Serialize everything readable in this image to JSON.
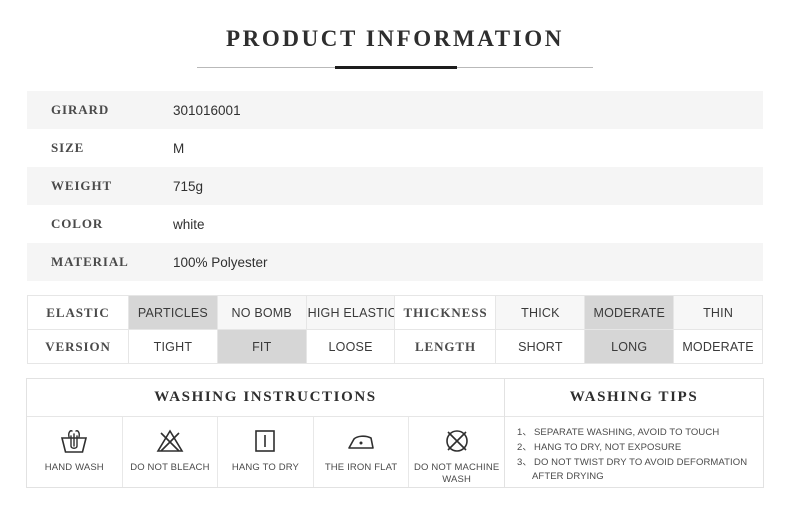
{
  "header": {
    "title": "PRODUCT INFORMATION"
  },
  "spec_table": {
    "rows": [
      {
        "label": "GIRARD",
        "value": "301016001"
      },
      {
        "label": "SIZE",
        "value": "M"
      },
      {
        "label": "WEIGHT",
        "value": "715g"
      },
      {
        "label": "COLOR",
        "value": "white"
      },
      {
        "label": "MATERIAL",
        "value": "100% Polyester"
      }
    ]
  },
  "attributes": {
    "rows": [
      {
        "left_label": "ELASTIC",
        "left_options": [
          {
            "text": "PARTICLES",
            "selected": true
          },
          {
            "text": "NO BOMB",
            "selected": false
          },
          {
            "text": "HIGH ELASTIC",
            "selected": false
          }
        ],
        "right_label": "THICKNESS",
        "right_options": [
          {
            "text": "THICK",
            "selected": false
          },
          {
            "text": "MODERATE",
            "selected": true
          },
          {
            "text": "THIN",
            "selected": false
          }
        ]
      },
      {
        "left_label": "VERSION",
        "left_options": [
          {
            "text": "TIGHT",
            "selected": false
          },
          {
            "text": "FIT",
            "selected": true
          },
          {
            "text": "LOOSE",
            "selected": false
          }
        ],
        "right_label": "LENGTH",
        "right_options": [
          {
            "text": "SHORT",
            "selected": false
          },
          {
            "text": "LONG",
            "selected": true
          },
          {
            "text": "MODERATE",
            "selected": false
          }
        ]
      }
    ]
  },
  "washing_instructions": {
    "heading": "WASHING INSTRUCTIONS",
    "items": [
      {
        "icon": "hand-wash-icon",
        "label": "HAND WASH"
      },
      {
        "icon": "do-not-bleach-icon",
        "label": "DO NOT BLEACH"
      },
      {
        "icon": "hang-to-dry-icon",
        "label": "HANG TO DRY"
      },
      {
        "icon": "iron-flat-icon",
        "label": "THE IRON FLAT"
      },
      {
        "icon": "do-not-machine-wash-icon",
        "label": "DO NOT MACHINE WASH"
      }
    ]
  },
  "washing_tips": {
    "heading": "WASHING TIPS",
    "items": [
      {
        "num": "1、",
        "text": "SEPARATE WASHING, AVOID TO TOUCH",
        "cont": ""
      },
      {
        "num": "2、",
        "text": "HANG TO DRY, NOT EXPOSURE",
        "cont": ""
      },
      {
        "num": "3、",
        "text": "DO NOT TWIST DRY TO AVOID DEFORMATION",
        "cont": "AFTER DRYING"
      }
    ]
  },
  "colors": {
    "page_background": "#ffffff",
    "text": "#3c3c3c",
    "row_alt_background": "#f5f5f5",
    "highlight_background": "#d6d6d6",
    "border": "#e2e2e2",
    "rule_dark": "#1d1d1d",
    "rule_light": "#b9b9b9"
  }
}
